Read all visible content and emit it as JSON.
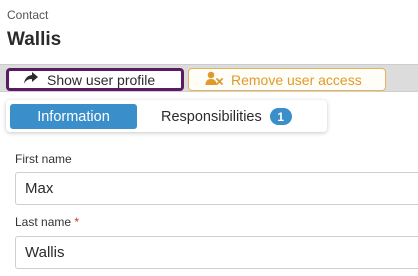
{
  "header": {
    "kicker": "Contact",
    "title": "Wallis"
  },
  "toolbar": {
    "show_profile_label": "Show user profile",
    "remove_access_label": "Remove user access",
    "show_profile_icon": "share-arrow-icon",
    "remove_access_icon": "user-remove-icon"
  },
  "tabs": [
    {
      "label": "Information",
      "active": true
    },
    {
      "label": "Responsibilities",
      "badge": "1",
      "active": false
    }
  ],
  "form": {
    "first_name": {
      "label": "First name",
      "value": "Max"
    },
    "last_name": {
      "label": "Last name",
      "required_mark": "*",
      "value": "Wallis"
    }
  },
  "colors": {
    "accent": "#3a8ec9",
    "primary_border": "#5b1a63",
    "warning": "#e09a2a",
    "toolbar_bg": "#dcdcdc"
  }
}
